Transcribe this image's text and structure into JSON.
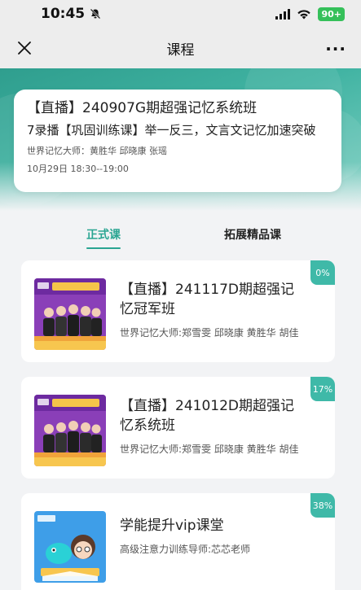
{
  "status_bar": {
    "time": "10:45",
    "battery": "90+"
  },
  "nav": {
    "title": "课程",
    "more": "···"
  },
  "live": {
    "title": "【直播】240907G期超强记忆系统班",
    "subtitle": "7录播【巩固训练课】举一反三，文言文记忆加速突破",
    "teachers": "世界记忆大师：黄胜华 邱晓康 张瑶",
    "time": "10月29日 18:30--19:00"
  },
  "tabs": [
    {
      "label": "正式课",
      "active": true
    },
    {
      "label": "拓展精品课",
      "active": false
    }
  ],
  "courses": [
    {
      "title": "【直播】241117D期超强记忆冠军班",
      "teachers": "世界记忆大师:郑雪雯 邱晓康 黄胜华 胡佳",
      "progress": "0%"
    },
    {
      "title": "【直播】241012D期超强记忆系统班",
      "teachers": "世界记忆大师:郑雪雯 邱晓康 黄胜华 胡佳",
      "progress": "17%"
    },
    {
      "title": "学能提升vip课堂",
      "teachers": "高级注意力训练导师:芯芯老师",
      "progress": "38%"
    }
  ],
  "colors": {
    "accent": "#2aa592",
    "badge": "#3fb9a8",
    "header_top": "#2f9e8e",
    "thumb_purple": "#8a3fb8",
    "thumb_blue": "#3e9ee8"
  },
  "icons": [
    "bell-muted-icon",
    "signal-icon",
    "wifi-icon",
    "close-icon",
    "more-icon"
  ]
}
